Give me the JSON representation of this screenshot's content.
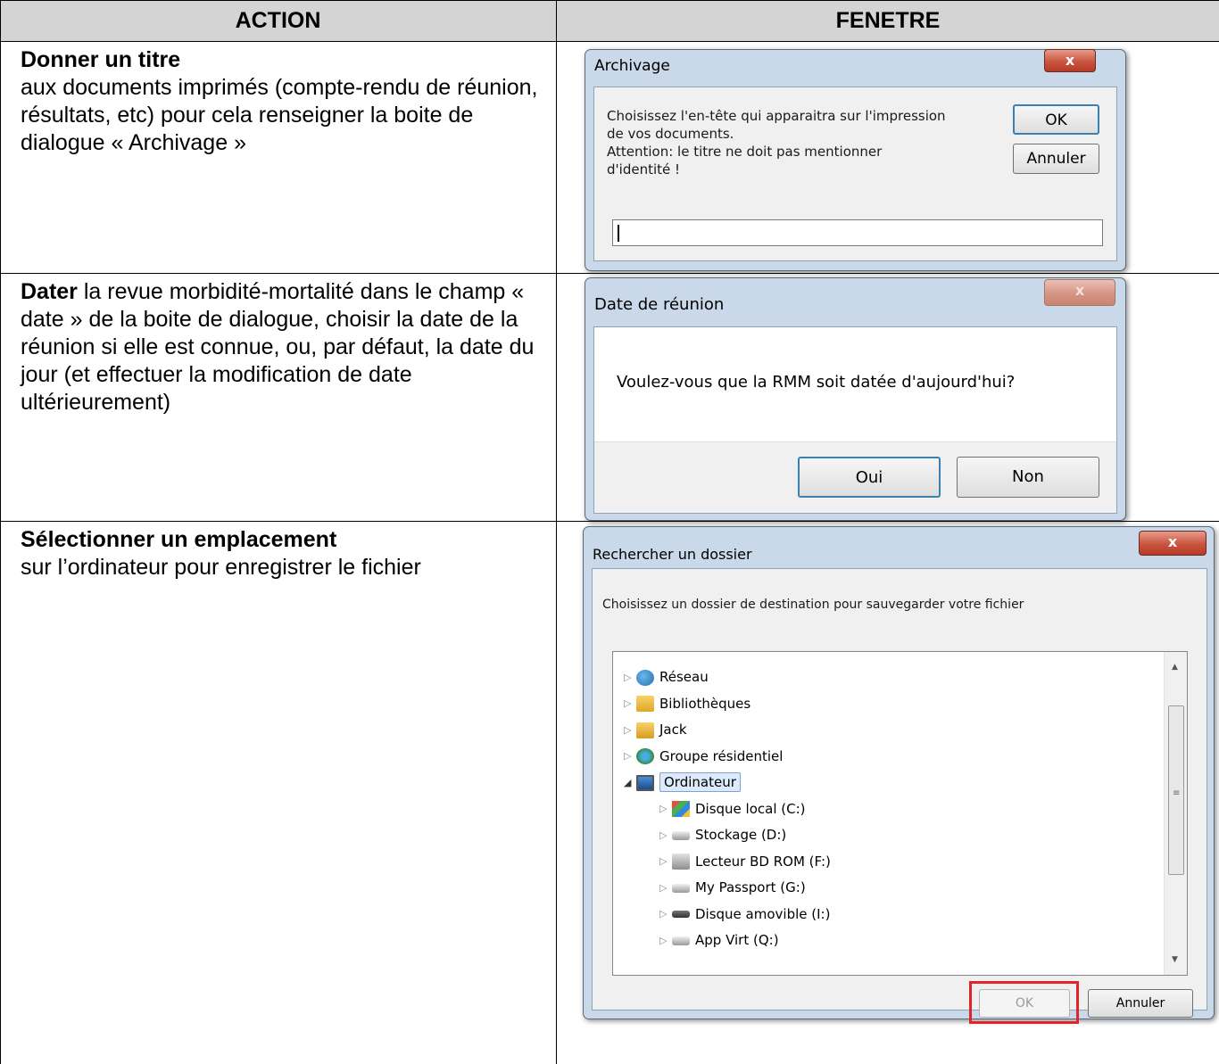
{
  "table": {
    "header": {
      "action": "ACTION",
      "fenetre": "FENETRE"
    },
    "rows": [
      {
        "title": "Donner un titre",
        "text": "aux documents imprimés (compte-rendu de réunion, résultats, etc)  pour cela renseigner la boite de dialogue « Archivage »"
      },
      {
        "title": "Dater",
        "text": " la revue morbidité-mortalité dans le champ « date » de la boite de dialogue, choisir la date de la réunion si elle est connue, ou, par défaut, la date du jour (et effectuer la modification de date ultérieurement)"
      },
      {
        "title": "Sélectionner un emplacement",
        "text": "sur l’ordinateur pour enregistrer le fichier"
      }
    ]
  },
  "dialog_archivage": {
    "title": "Archivage",
    "close_label": "x",
    "message_line1": "Choisissez l'en-tête qui apparaitra sur l'impression",
    "message_line2": "de vos documents.",
    "message_line3": "Attention: le titre ne doit pas mentionner",
    "message_line4": "d'identité !",
    "ok_label": "OK",
    "cancel_label": "Annuler",
    "input_value": ""
  },
  "dialog_date": {
    "title": "Date de réunion",
    "close_label": "x",
    "message": "Voulez-vous que la RMM soit datée d'aujourd'hui?",
    "yes_label": "Oui",
    "no_label": "Non"
  },
  "dialog_folder": {
    "title": "Rechercher un dossier",
    "close_label": "x",
    "instruction": "Choisissez un dossier de destination pour sauvegarder votre fichier",
    "tree": [
      {
        "label": "Réseau",
        "icon": "network-icon",
        "level": 0,
        "expander": "▷"
      },
      {
        "label": "Bibliothèques",
        "icon": "libraries-icon",
        "level": 0,
        "expander": "▷"
      },
      {
        "label": "Jack",
        "icon": "user-folder-icon",
        "level": 0,
        "expander": "▷"
      },
      {
        "label": "Groupe résidentiel",
        "icon": "homegroup-icon",
        "level": 0,
        "expander": "▷"
      },
      {
        "label": "Ordinateur",
        "icon": "computer-icon",
        "level": 0,
        "expander": "◢",
        "selected": true
      },
      {
        "label": "Disque local (C:)",
        "icon": "system-drive-icon",
        "level": 1,
        "expander": "▷"
      },
      {
        "label": "Stockage (D:)",
        "icon": "drive-icon",
        "level": 1,
        "expander": "▷"
      },
      {
        "label": "Lecteur BD ROM (F:)",
        "icon": "optical-drive-icon",
        "level": 1,
        "expander": "▷"
      },
      {
        "label": "My Passport (G:)",
        "icon": "drive-icon",
        "level": 1,
        "expander": "▷"
      },
      {
        "label": "Disque amovible (I:)",
        "icon": "removable-drive-icon",
        "level": 1,
        "expander": "▷"
      },
      {
        "label": "App Virt (Q:)",
        "icon": "drive-icon",
        "level": 1,
        "expander": "▷"
      }
    ],
    "ok_label": "OK",
    "cancel_label": "Annuler",
    "highlight_color": "#e0262c"
  }
}
